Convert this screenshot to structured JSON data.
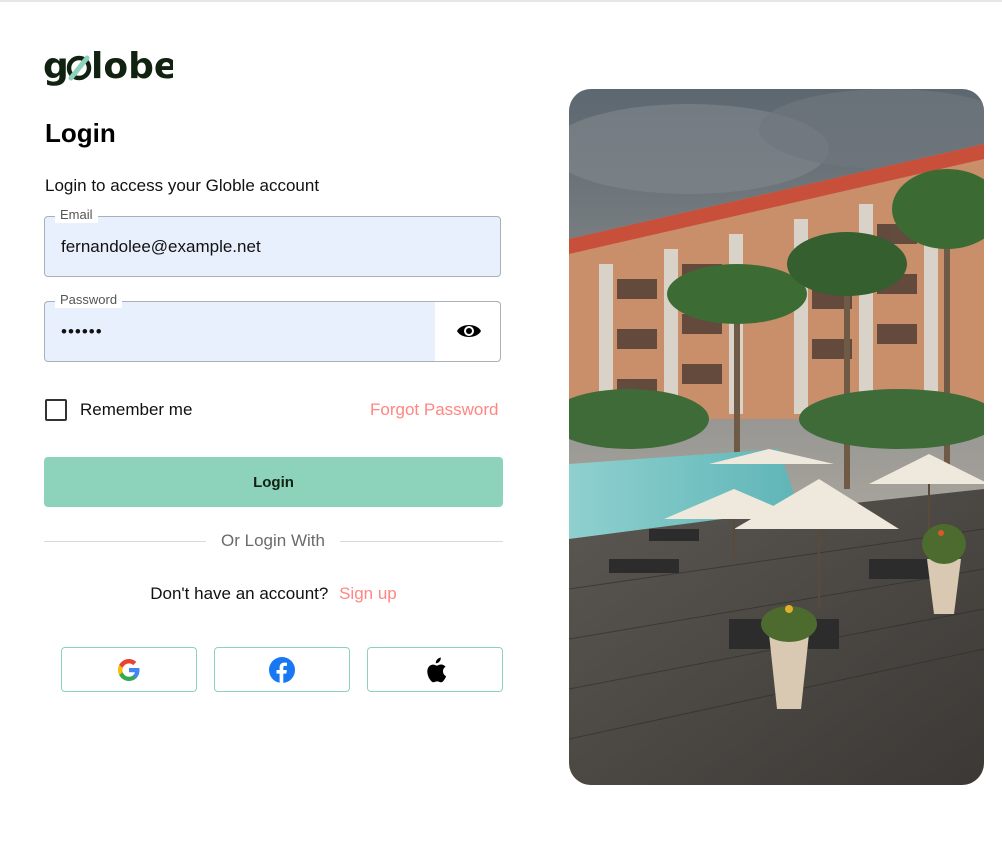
{
  "brand": {
    "logo_text": "golobe",
    "icon": "globe-link-logo"
  },
  "login": {
    "title": "Login",
    "subtitle": "Login to access your Globle account",
    "email": {
      "label": "Email",
      "value": "fernandolee@example.net"
    },
    "password": {
      "label": "Password",
      "value": "••••••",
      "toggle_icon": "eye-icon"
    },
    "remember_label": "Remember me",
    "forgot_label": "Forgot Password",
    "submit_label": "Login",
    "or_label": "Or Login With",
    "signup_prompt": "Don't have an account?",
    "signup_link": "Sign up",
    "social": [
      "google-icon",
      "facebook-icon",
      "apple-icon"
    ]
  },
  "colors": {
    "accent": "#8dd3bb",
    "link": "#ff8682",
    "input_bg": "#e8f0fe",
    "brand_dark": "#112211"
  },
  "hero_image": {
    "subject": "resort-pool-photo"
  }
}
